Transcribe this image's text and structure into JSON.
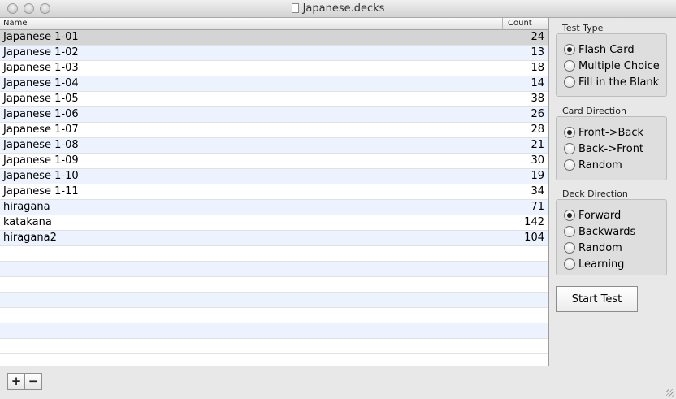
{
  "window": {
    "title": "Japanese.decks"
  },
  "table": {
    "columns": {
      "name": "Name",
      "count": "Count"
    },
    "rows": [
      {
        "name": "Japanese 1-01",
        "count": "24"
      },
      {
        "name": "Japanese 1-02",
        "count": "13"
      },
      {
        "name": "Japanese 1-03",
        "count": "18"
      },
      {
        "name": "Japanese 1-04",
        "count": "14"
      },
      {
        "name": "Japanese 1-05",
        "count": "38"
      },
      {
        "name": "Japanese 1-06",
        "count": "26"
      },
      {
        "name": "Japanese 1-07",
        "count": "28"
      },
      {
        "name": "Japanese 1-08",
        "count": "21"
      },
      {
        "name": "Japanese 1-09",
        "count": "30"
      },
      {
        "name": "Japanese 1-10",
        "count": "19"
      },
      {
        "name": "Japanese 1-11",
        "count": "34"
      },
      {
        "name": "hiragana",
        "count": "71"
      },
      {
        "name": "katakana",
        "count": "142"
      },
      {
        "name": "hiragana2",
        "count": "104"
      }
    ]
  },
  "test_type": {
    "label": "Test Type",
    "options": [
      "Flash Card",
      "Multiple Choice",
      "Fill in the Blank"
    ],
    "selected": "Flash Card"
  },
  "card_direction": {
    "label": "Card Direction",
    "options": [
      "Front->Back",
      "Back->Front",
      "Random"
    ],
    "selected": "Front->Back"
  },
  "deck_direction": {
    "label": "Deck Direction",
    "options": [
      "Forward",
      "Backwards",
      "Random",
      "Learning"
    ],
    "selected": "Forward"
  },
  "buttons": {
    "start": "Start Test",
    "add": "+",
    "remove": "−"
  }
}
